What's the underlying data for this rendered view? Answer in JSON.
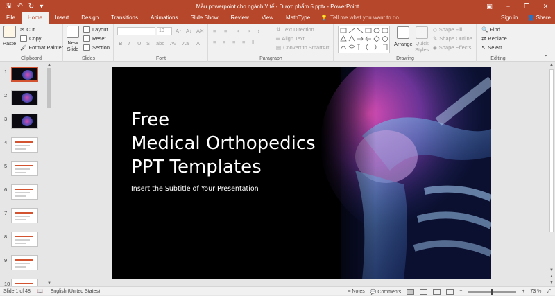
{
  "window": {
    "title": "Mẫu powerpoint cho ngành Y tế - Dược phẩm 5.pptx - PowerPoint",
    "qat": [
      "save-icon",
      "undo-icon",
      "redo-icon",
      "customize-icon"
    ],
    "controls": [
      "ribbon-display-icon",
      "minimize-icon",
      "restore-icon",
      "close-icon"
    ]
  },
  "tabs": [
    "File",
    "Home",
    "Insert",
    "Design",
    "Transitions",
    "Animations",
    "Slide Show",
    "Review",
    "View",
    "MathType"
  ],
  "active_tab": "Home",
  "tell_me": "Tell me what you want to do...",
  "signin": "Sign in",
  "share": "Share",
  "ribbon": {
    "clipboard": {
      "label": "Clipboard",
      "paste": "Paste",
      "cut": "Cut",
      "copy": "Copy",
      "format_painter": "Format Painter"
    },
    "slides": {
      "label": "Slides",
      "new_slide_1": "New",
      "new_slide_2": "Slide",
      "layout": "Layout",
      "reset": "Reset",
      "section": "Section"
    },
    "font": {
      "label": "Font",
      "font_size": "10"
    },
    "paragraph": {
      "label": "Paragraph",
      "text_direction": "Text Direction",
      "align_text": "Align Text",
      "convert_smartart": "Convert to SmartArt"
    },
    "drawing": {
      "label": "Drawing",
      "arrange": "Arrange",
      "quick_styles_1": "Quick",
      "quick_styles_2": "Styles",
      "shape_fill": "Shape Fill",
      "shape_outline": "Shape Outline",
      "shape_effects": "Shape Effects"
    },
    "editing": {
      "label": "Editing",
      "find": "Find",
      "replace": "Replace",
      "select": "Select"
    }
  },
  "thumbnails": [
    {
      "num": "1",
      "style": "dark"
    },
    {
      "num": "2",
      "style": "dark"
    },
    {
      "num": "3",
      "style": "dark"
    },
    {
      "num": "4",
      "style": "light"
    },
    {
      "num": "5",
      "style": "light"
    },
    {
      "num": "6",
      "style": "light"
    },
    {
      "num": "7",
      "style": "light"
    },
    {
      "num": "8",
      "style": "light"
    },
    {
      "num": "9",
      "style": "light"
    },
    {
      "num": "10",
      "style": "light"
    }
  ],
  "slide": {
    "title": "Free\nMedical Orthopedics\nPPT Templates",
    "subtitle": "Insert the Subtitle of Your Presentation"
  },
  "status": {
    "slide_info": "Slide 1 of 48",
    "language": "English (United States)",
    "notes": "Notes",
    "comments": "Comments",
    "zoom": "73 %"
  },
  "colors": {
    "accent": "#b7472a",
    "slide_bg": "#000000",
    "xray": "#c13a9c"
  }
}
